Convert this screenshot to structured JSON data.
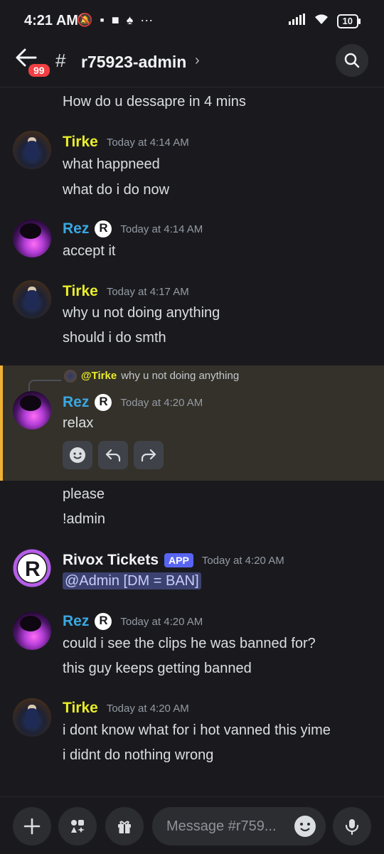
{
  "status_bar": {
    "time": "4:21 AM",
    "battery": "10",
    "more": "···"
  },
  "header": {
    "channel_name": "r75923-admin",
    "unread_badge": "99",
    "chevron": "›",
    "hash": "#"
  },
  "messages": [
    {
      "type": "continuation",
      "text": "How do u dessapre in 4 mins"
    },
    {
      "author": "Tirke",
      "time": "Today at 4:14 AM",
      "lines": [
        "what happneed",
        "what do i do now"
      ]
    },
    {
      "author": "Rez",
      "time": "Today at 4:14 AM",
      "lines": [
        "accept it"
      ]
    },
    {
      "author": "Tirke",
      "time": "Today at 4:17 AM",
      "lines": [
        "why u not doing anything",
        "should i do smth"
      ]
    },
    {
      "author": "Rez",
      "time": "Today at 4:20 AM",
      "reply_to": {
        "name": "@Tirke",
        "text": "why u not doing anything"
      },
      "lines": [
        "relax"
      ]
    },
    {
      "type": "continuation",
      "lines": [
        "please",
        "!admin"
      ]
    },
    {
      "author": "Rivox Tickets",
      "tag": "APP",
      "time": "Today at 4:20 AM",
      "lines": [
        "@Admin [DM = BAN]"
      ]
    },
    {
      "author": "Rez",
      "time": "Today at 4:20 AM",
      "lines": [
        "could i see the clips he was banned for?",
        "this guy keeps getting banned"
      ]
    },
    {
      "author": "Tirke",
      "time": "Today at 4:20 AM",
      "lines": [
        "i dont know what for i hot vanned this yime",
        "i didnt do nothing wrong"
      ]
    }
  ],
  "composer": {
    "placeholder": "Message #r759..."
  },
  "colors": {
    "tirke_name": "#e9ed2a",
    "rez_name": "#3aa8e2",
    "highlight_border": "#f0b232",
    "app_tag": "#5865f2",
    "badge": "#f23f43"
  }
}
